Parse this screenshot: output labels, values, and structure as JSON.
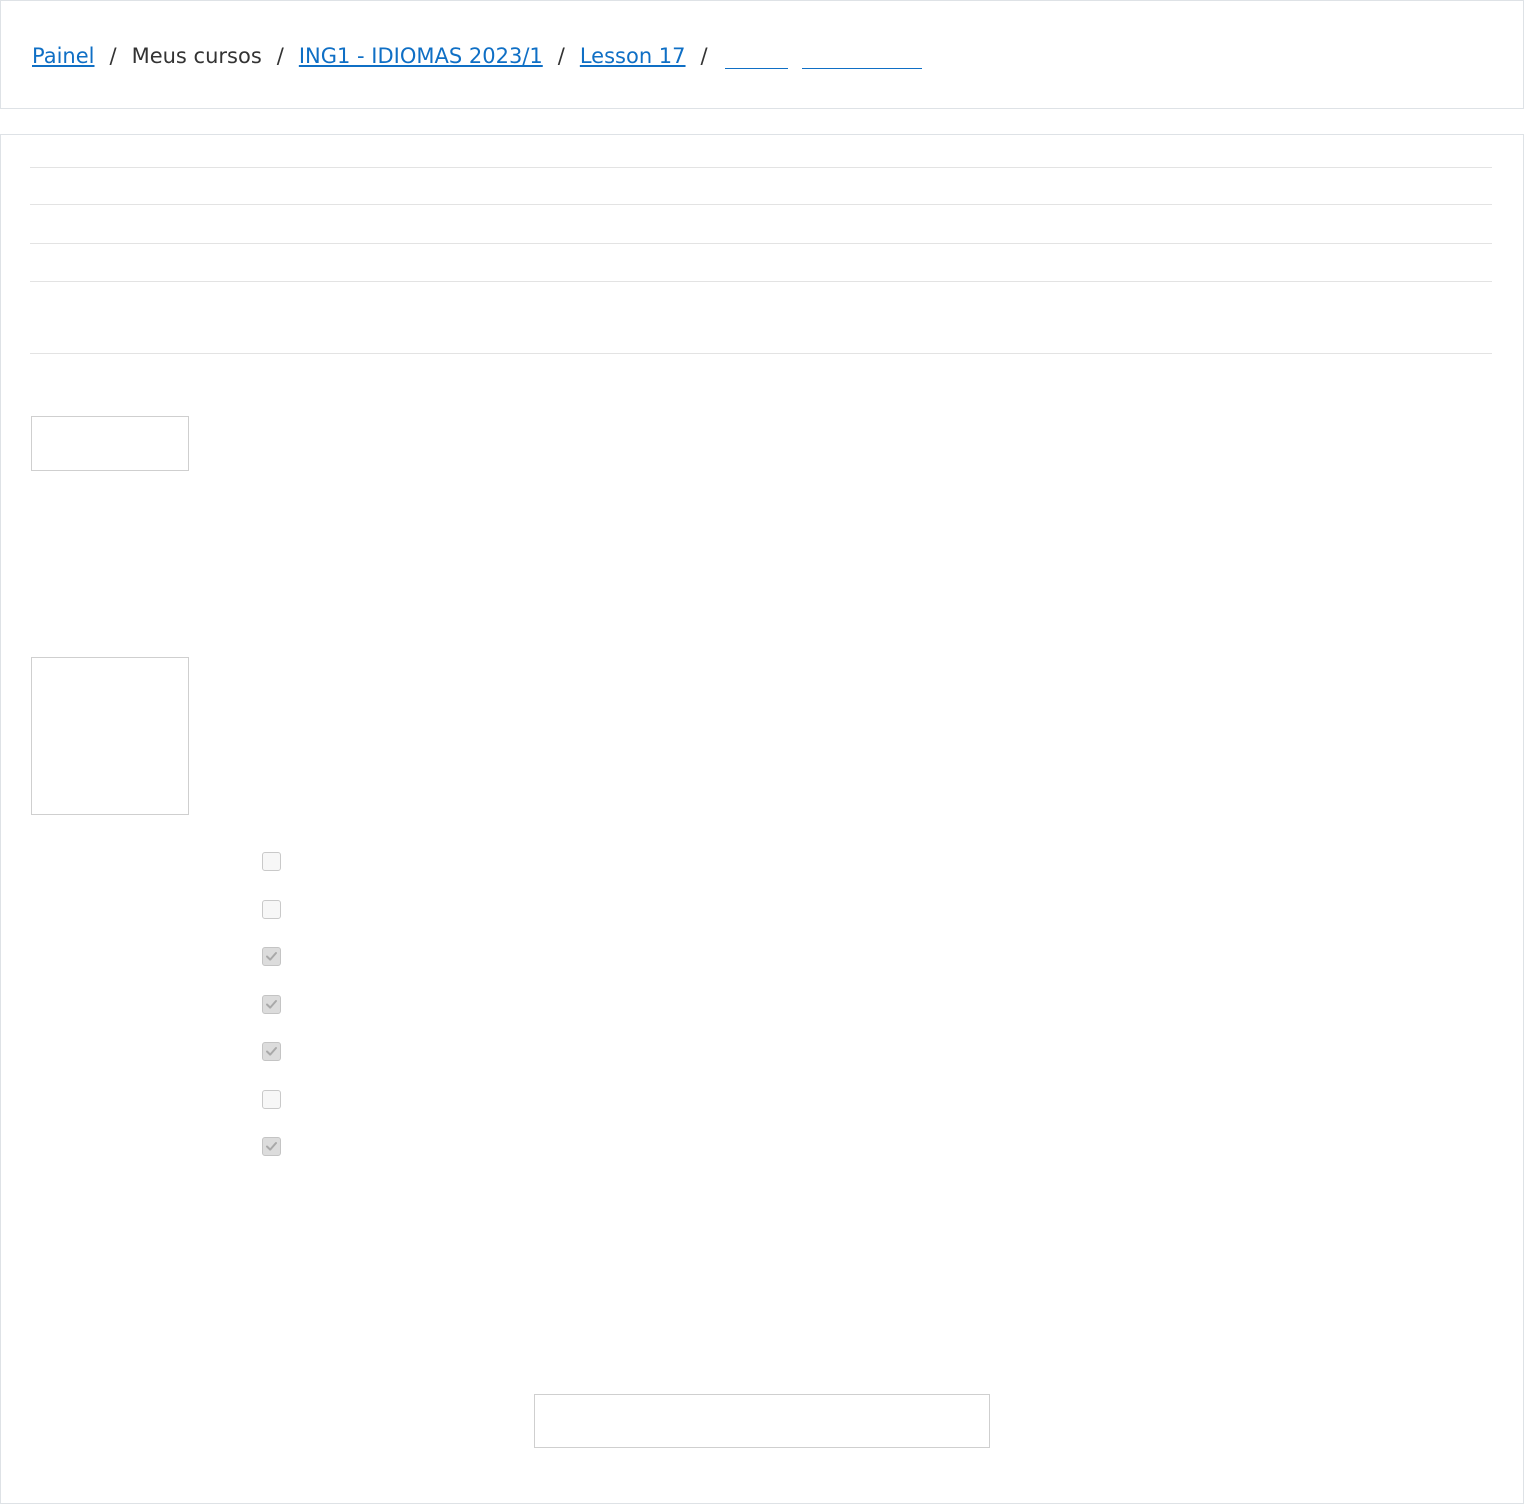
{
  "breadcrumb": {
    "items": [
      {
        "label": "Painel",
        "link": true
      },
      {
        "label": "Meus cursos",
        "link": false
      },
      {
        "label": "ING1 - IDIOMAS 2023/1",
        "link": true
      },
      {
        "label": "Lesson 17",
        "link": true
      }
    ],
    "separator": "/"
  },
  "quiz": {
    "options": [
      {
        "checked": false
      },
      {
        "checked": false
      },
      {
        "checked": true
      },
      {
        "checked": true
      },
      {
        "checked": true
      },
      {
        "checked": false
      },
      {
        "checked": true
      }
    ]
  },
  "colors": {
    "link": "#0f6fc5",
    "text": "#333333",
    "border": "#dee2e6"
  },
  "icons": [
    "check-icon"
  ]
}
